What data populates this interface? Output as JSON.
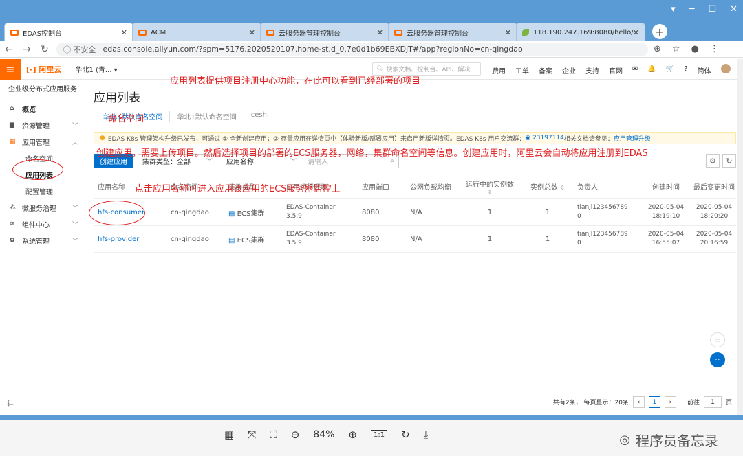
{
  "window": {
    "controls": [
      "▾",
      "─",
      "☐",
      "✕"
    ]
  },
  "tabs": [
    {
      "label": "EDAS控制台",
      "close": "✕"
    },
    {
      "label": "ACM",
      "close": "✕"
    },
    {
      "label": "云服务器管理控制台",
      "close": "✕"
    },
    {
      "label": "云服务器管理控制台",
      "close": "✕"
    },
    {
      "label": "118.190.247.169:8080/hello/",
      "close": "✕"
    }
  ],
  "addressbar": {
    "security": "ⓘ 不安全",
    "url": "edas.console.aliyun.com/?spm=5176.2020520107.home-st.d_0.7e0d1b69EBXDjT#/app?regionNo=cn-qingdao"
  },
  "topbar": {
    "logo": "[-] 阿里云",
    "region": "华北1 (青... ▾",
    "search_placeholder": "搜索文档、控制台、API、解决",
    "nav": [
      "费用",
      "工单",
      "备案",
      "企业",
      "支持",
      "官网",
      "✉",
      "🔔",
      "🛒",
      "?",
      "简体"
    ]
  },
  "sidebar": {
    "header": "企业级分布式应用服务",
    "items": [
      {
        "label": "概览",
        "icon": "home-icon"
      },
      {
        "label": "资源管理",
        "icon": "folder-icon"
      },
      {
        "label": "应用管理",
        "icon": "grid-icon"
      },
      {
        "label": "微服务治理",
        "icon": "network-icon"
      },
      {
        "label": "组件中心",
        "icon": "layers-icon"
      },
      {
        "label": "系统管理",
        "icon": "gear-icon"
      }
    ],
    "subitems": [
      "命名空间",
      "应用列表",
      "配置管理"
    ]
  },
  "main": {
    "title": "应用列表",
    "ns_tabs": [
      "华北1默认命名空间",
      "华北1默认命名空间",
      "ceshi"
    ],
    "notice": {
      "text": "EDAS K8s 管理架构升级已发布，可通过 ① 全新创建应用；② 存量应用在详情页中【体验新版/部署应用】来启用新版详情页。EDAS K8s 用户交流群：",
      "group": "23197114",
      "text2": " 相关文档请参见：",
      "link": "应用管理升级"
    },
    "create_button": "创建应用",
    "cluster_select": "集群类型：全部",
    "field_select": "应用名称",
    "search_placeholder": "请输入",
    "columns": [
      "应用名称",
      "命名空间",
      "集群类型",
      "应用运行环境",
      "应用端口",
      "公网负载均衡",
      "运行中的实例数",
      "实例总数",
      "负责人",
      "创建时间",
      "最后变更时间"
    ],
    "rows": [
      {
        "name": "hfs-consumer",
        "ns": "cn-qingdao",
        "cluster": "ECS集群",
        "env1": "EDAS-Container",
        "env2": "3.5.9",
        "port": "8080",
        "slb": "N/A",
        "running": "1",
        "total": "1",
        "owner1": "tianjl123456789",
        "owner2": "0",
        "created1": "2020-05-04",
        "created2": "18:19:10",
        "changed1": "2020-05-04",
        "changed2": "18:20:20"
      },
      {
        "name": "hfs-provider",
        "ns": "cn-qingdao",
        "cluster": "ECS集群",
        "env1": "EDAS-Container",
        "env2": "3.5.9",
        "port": "8080",
        "slb": "N/A",
        "running": "1",
        "total": "1",
        "owner1": "tianjl123456789",
        "owner2": "0",
        "created1": "2020-05-04",
        "created2": "16:55:07",
        "changed1": "2020-05-04",
        "changed2": "20:16:59"
      }
    ],
    "pager": {
      "summary": "共有2条， 每页显示：20条",
      "page": "1",
      "goto_label": "前往",
      "goto_value": "1",
      "page_suffix": "页"
    }
  },
  "annotations": {
    "a1": "应用列表提供项目注册中心功能，在此可以看到已经部署的项目",
    "a2": "命名空间",
    "a3": "创建应用，需要上传项目。然后选择项目的部署的ECS服务器，网络，集群命名空间等信息。创建应用时，阿里云会自动将应用注册到EDAS",
    "a4": "点击应用名称可进入应用该应用的ECS服务器监控上"
  },
  "viewer": {
    "zoom": "84%",
    "ratio": "1:1",
    "watermark": "程序员备忘录"
  }
}
